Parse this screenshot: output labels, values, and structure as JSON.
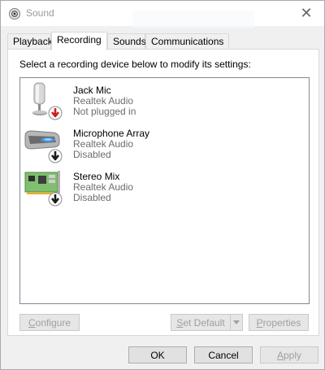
{
  "window": {
    "title": "Sound",
    "close_glyph": "✕"
  },
  "tabs": [
    {
      "label": "Playback",
      "active": false
    },
    {
      "label": "Recording",
      "active": true
    },
    {
      "label": "Sounds",
      "active": false
    },
    {
      "label": "Communications",
      "active": false
    }
  ],
  "panel": {
    "instruction": "Select a recording device below to modify its settings:"
  },
  "devices": [
    {
      "name": "Jack Mic",
      "driver": "Realtek Audio",
      "status": "Not plugged in",
      "icon": "microphone-icon",
      "badge": "red-down-arrow-badge"
    },
    {
      "name": "Microphone Array",
      "driver": "Realtek Audio",
      "status": "Disabled",
      "icon": "microphone-array-icon",
      "badge": "black-down-arrow-badge"
    },
    {
      "name": "Stereo Mix",
      "driver": "Realtek Audio",
      "status": "Disabled",
      "icon": "sound-card-icon",
      "badge": "black-down-arrow-badge"
    }
  ],
  "buttons": {
    "configure": {
      "mnemonic": "C",
      "rest": "onfigure",
      "enabled": false
    },
    "set_default": {
      "mnemonic": "S",
      "rest": "et Default",
      "enabled": false
    },
    "properties": {
      "mnemonic": "P",
      "rest": "roperties",
      "enabled": false
    },
    "ok": {
      "label": "OK",
      "enabled": true
    },
    "cancel": {
      "label": "Cancel",
      "enabled": true
    },
    "apply": {
      "mnemonic": "A",
      "rest": "pply",
      "enabled": false
    }
  },
  "colors": {
    "badge_red": "#cc1f1f",
    "badge_black": "#1a1a1a",
    "disabled_text": "#a0a0a0"
  }
}
